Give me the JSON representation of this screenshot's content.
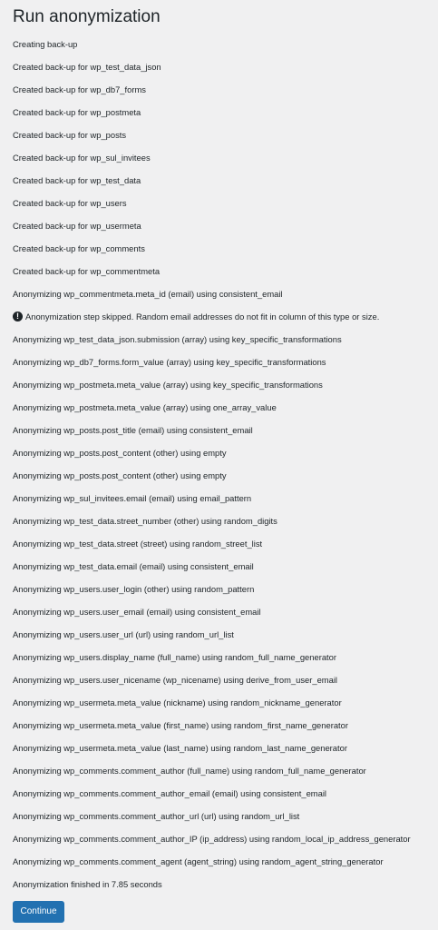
{
  "page": {
    "title": "Run anonymization"
  },
  "log": [
    {
      "text": "Creating back-up"
    },
    {
      "text": "Created back-up for wp_test_data_json"
    },
    {
      "text": "Created back-up for wp_db7_forms"
    },
    {
      "text": "Created back-up for wp_postmeta"
    },
    {
      "text": "Created back-up for wp_posts"
    },
    {
      "text": "Created back-up for wp_sul_invitees"
    },
    {
      "text": "Created back-up for wp_test_data"
    },
    {
      "text": "Created back-up for wp_users"
    },
    {
      "text": "Created back-up for wp_usermeta"
    },
    {
      "text": "Created back-up for wp_comments"
    },
    {
      "text": "Created back-up for wp_commentmeta"
    },
    {
      "text": "Anonymizing wp_commentmeta.meta_id (email) using consistent_email"
    },
    {
      "text": "Anonymization step skipped. Random email addresses do not fit in column of this type or size.",
      "icon": "exclamation-circle-icon",
      "icon_glyph": "!"
    },
    {
      "text": "Anonymizing wp_test_data_json.submission (array) using key_specific_transformations"
    },
    {
      "text": "Anonymizing wp_db7_forms.form_value (array) using key_specific_transformations"
    },
    {
      "text": "Anonymizing wp_postmeta.meta_value (array) using key_specific_transformations"
    },
    {
      "text": "Anonymizing wp_postmeta.meta_value (array) using one_array_value"
    },
    {
      "text": "Anonymizing wp_posts.post_title (email) using consistent_email"
    },
    {
      "text": "Anonymizing wp_posts.post_content (other) using empty"
    },
    {
      "text": "Anonymizing wp_posts.post_content (other) using empty"
    },
    {
      "text": "Anonymizing wp_sul_invitees.email (email) using email_pattern"
    },
    {
      "text": "Anonymizing wp_test_data.street_number (other) using random_digits"
    },
    {
      "text": "Anonymizing wp_test_data.street (street) using random_street_list"
    },
    {
      "text": "Anonymizing wp_test_data.email (email) using consistent_email"
    },
    {
      "text": "Anonymizing wp_users.user_login (other) using random_pattern"
    },
    {
      "text": "Anonymizing wp_users.user_email (email) using consistent_email"
    },
    {
      "text": "Anonymizing wp_users.user_url (url) using random_url_list"
    },
    {
      "text": "Anonymizing wp_users.display_name (full_name) using random_full_name_generator"
    },
    {
      "text": "Anonymizing wp_users.user_nicename (wp_nicename) using derive_from_user_email"
    },
    {
      "text": "Anonymizing wp_usermeta.meta_value (nickname) using random_nickname_generator"
    },
    {
      "text": "Anonymizing wp_usermeta.meta_value (first_name) using random_first_name_generator"
    },
    {
      "text": "Anonymizing wp_usermeta.meta_value (last_name) using random_last_name_generator"
    },
    {
      "text": "Anonymizing wp_comments.comment_author (full_name) using random_full_name_generator"
    },
    {
      "text": "Anonymizing wp_comments.comment_author_email (email) using consistent_email"
    },
    {
      "text": "Anonymizing wp_comments.comment_author_url (url) using random_url_list"
    },
    {
      "text": "Anonymizing wp_comments.comment_author_IP (ip_address) using random_local_ip_address_generator"
    },
    {
      "text": "Anonymizing wp_comments.comment_agent (agent_string) using random_agent_string_generator"
    },
    {
      "text": "Anonymization finished in 7.85 seconds"
    }
  ],
  "actions": {
    "continue_label": "Continue"
  },
  "colors": {
    "background": "#f0f0f1",
    "text": "#1d2327",
    "primary_button": "#2271b1"
  }
}
